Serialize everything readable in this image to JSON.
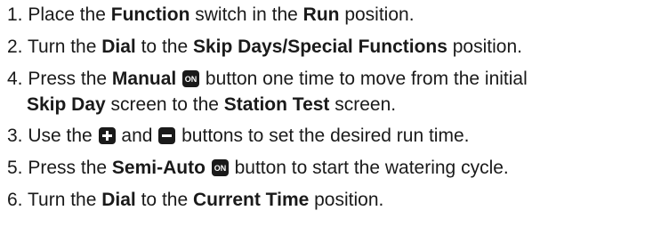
{
  "steps": [
    {
      "n": "1.",
      "a": "Place the ",
      "b1": "Function",
      "c": " switch in the ",
      "b2": "Run",
      "d": " position."
    },
    {
      "n": "2.",
      "a": "Turn the ",
      "b1": "Dial",
      "c": " to the ",
      "b2": "Skip Days/Special Functions",
      "d": " position."
    },
    {
      "n": "4.",
      "a": "Press the ",
      "b1": "Manual",
      "c": " button one time to move from the initial",
      "b2": "Skip Day",
      "d": " screen to the ",
      "b3": "Station Test",
      "e": " screen."
    },
    {
      "n": "3.",
      "a": "Use the ",
      "c": " and ",
      "d": " buttons to set the desired run time."
    },
    {
      "n": "5.",
      "a": "Press the ",
      "b1": "Semi-Auto",
      "c": " button to start the watering cycle."
    },
    {
      "n": "6.",
      "a": "Turn the ",
      "b1": "Dial",
      "c": " to the ",
      "b2": "Current Time",
      "d": " position."
    }
  ],
  "icons": {
    "on": "ON",
    "plus": "plus-icon",
    "minus": "minus-icon"
  }
}
